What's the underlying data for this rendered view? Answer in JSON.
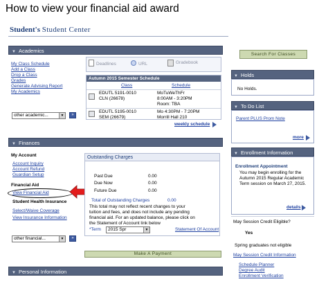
{
  "doc_title": "How to view your financial aid award",
  "header": {
    "title_owner": "Student's",
    "title_center": "Student Center"
  },
  "academics": {
    "bar_label": "Academics",
    "links": [
      "My Class Schedule",
      "Add a Class",
      "Drop a Class",
      "Grades",
      "Generate Advising Report",
      "My Academics"
    ],
    "select_value": "other academic...",
    "tabs": {
      "deadlines": "Deadlines",
      "url": "URL",
      "gradebook": "Gradebook"
    },
    "schedule": {
      "header": "Autumn 2015 Semester Schedule",
      "col_class": "Class",
      "col_schedule": "Schedule",
      "rows": [
        {
          "class_line1": "EDUTL 5191-0010",
          "class_line2": "CLN (26678)",
          "sched_line1": "MoTuWeThFr",
          "sched_line2": "8:00AM - 3:20PM",
          "sched_line3": "Room: TBA"
        },
        {
          "class_line1": "EDUTL 5195-0010",
          "class_line2": "SEM (26679)",
          "sched_line1": "Mo 4:30PM - 7:20PM",
          "sched_line2": "Morrill Hall 210",
          "sched_line3": ""
        }
      ],
      "weekly_link": "weekly schedule"
    }
  },
  "search_button": "Search For Classes",
  "holds": {
    "bar_label": "Holds",
    "text": "No Holds."
  },
  "todo": {
    "bar_label": "To Do List",
    "item": "Parent PLUS Prom Note",
    "more": "more"
  },
  "finances": {
    "bar_label": "Finances",
    "my_account_label": "My Account",
    "account_links": [
      "Account Inquiry",
      "Account Refund",
      "Guardian Setup"
    ],
    "financial_aid_label": "Financial Aid",
    "view_financial_aid": "View Financial Aid",
    "student_health_label": "Student Health Insurance",
    "health_links": [
      "Select/Waive Coverage",
      "View Insurance Information"
    ],
    "select_value": "other financial...",
    "outstanding": {
      "header": "Outstanding Charges",
      "rows": [
        {
          "label": "Past Due",
          "amount": "0.00"
        },
        {
          "label": "Due Now",
          "amount": "0.00"
        },
        {
          "label": "Future Due",
          "amount": "0.00"
        }
      ],
      "total_label": "Total of Outstanding Charges",
      "total_amount": "0.00",
      "note": [
        "This total may not reflect recent changes to your",
        "tuition and fees, and does not include any pending",
        "financial aid. For an updated balance, please click on",
        "the Statement of Account link below"
      ],
      "term_label": "*Term",
      "term_value": "2015 Spr",
      "statement_link": "Statement Of Account"
    },
    "payment_button": "Make A Payment"
  },
  "enrollment": {
    "bar_label": "Enrollment Information",
    "appointment_title": "Enrollment Appointment",
    "appointment_text": [
      "You may begin enrolling for the",
      "Autumn 2015 Regular Academic",
      "Term session on March 27, 2015."
    ],
    "details": "details",
    "eligible_q": "May Session Credit Eligible?",
    "eligible_a": "Yes",
    "spring_note": "Spring graduates not eligible",
    "may_info_link": "May Session Credit Information",
    "links": [
      "Schedule Planner",
      "Degree Audit",
      "Enrollment Verification"
    ]
  },
  "personal": {
    "bar_label": "Personal Information"
  },
  "colors": {
    "bar": "#55637f",
    "link": "#1d3fa0",
    "arrow": "#e31c1c"
  }
}
